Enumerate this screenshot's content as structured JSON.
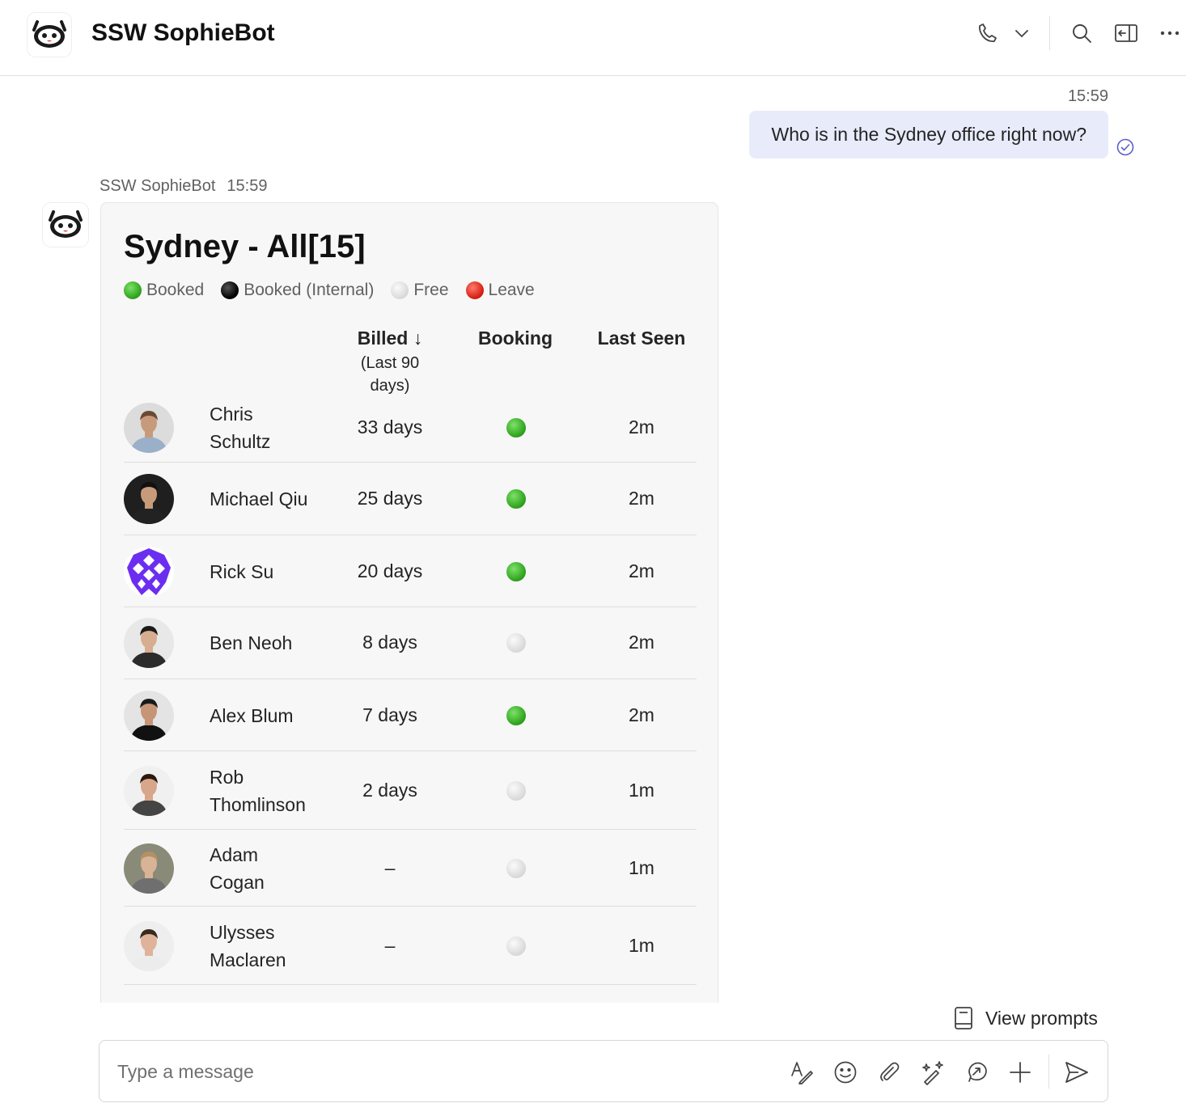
{
  "header": {
    "title": "SSW SophieBot"
  },
  "user_message": {
    "time": "15:59",
    "text": "Who is in the Sydney office right now?"
  },
  "bot_message": {
    "sender": "SSW SophieBot",
    "time": "15:59"
  },
  "card": {
    "title": "Sydney - All[15]",
    "legend": [
      {
        "label": "Booked",
        "status": "booked"
      },
      {
        "label": "Booked (Internal)",
        "status": "internal"
      },
      {
        "label": "Free",
        "status": "free"
      },
      {
        "label": "Leave",
        "status": "leave"
      }
    ],
    "columns": {
      "billed": "Billed ↓",
      "billed_sub_1": "(Last 90",
      "billed_sub_2": "days)",
      "booking": "Booking",
      "last_seen": "Last Seen"
    },
    "rows": [
      {
        "name_1": "Chris",
        "name_2": "Schultz",
        "billed": "33 days",
        "booking": "booked",
        "last_seen": "2m"
      },
      {
        "name_1": "Michael Qiu",
        "name_2": "",
        "billed": "25 days",
        "booking": "booked",
        "last_seen": "2m"
      },
      {
        "name_1": "Rick Su",
        "name_2": "",
        "billed": "20 days",
        "booking": "booked",
        "last_seen": "2m"
      },
      {
        "name_1": "Ben Neoh",
        "name_2": "",
        "billed": "8 days",
        "booking": "free",
        "last_seen": "2m"
      },
      {
        "name_1": "Alex Blum",
        "name_2": "",
        "billed": "7 days",
        "booking": "booked",
        "last_seen": "2m"
      },
      {
        "name_1": "Rob",
        "name_2": "Thomlinson",
        "billed": "2 days",
        "booking": "free",
        "last_seen": "1m"
      },
      {
        "name_1": "Adam",
        "name_2": "Cogan",
        "billed": "–",
        "booking": "free",
        "last_seen": "1m"
      },
      {
        "name_1": "Ulysses",
        "name_2": "Maclaren",
        "billed": "–",
        "booking": "free",
        "last_seen": "1m"
      }
    ]
  },
  "footer": {
    "view_prompts": "View prompts",
    "composer_placeholder": "Type a message"
  },
  "colors": {
    "accent": "#5b5fc7",
    "bubble": "#e8ebfa",
    "booked": "#2fa51d",
    "leave": "#d71f13"
  }
}
